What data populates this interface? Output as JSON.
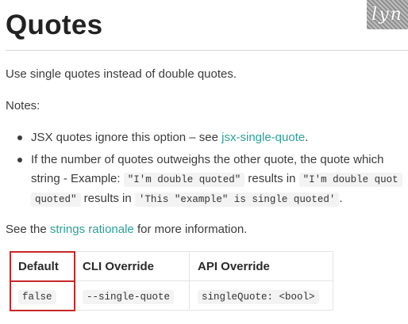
{
  "header": {
    "title": "Quotes",
    "logo_text": "lyn"
  },
  "content": {
    "intro": "Use single quotes instead of double quotes.",
    "notes_label": "Notes:",
    "bullet1": {
      "text": "JSX quotes ignore this option – see ",
      "link": "jsx-single-quote",
      "end": "."
    },
    "bullet2": {
      "line1": "If the number of quotes outweighs the other quote, the quote which",
      "line2_prefix": "string - Example: ",
      "code1": "\"I'm double quoted\"",
      "results_in": " results in ",
      "code2": "\"I'm double quot",
      "code2_cont": "quoted\"",
      "results_in_2": " results in ",
      "code3": "'This \"example\" is single quoted'",
      "end": "."
    },
    "see": {
      "prefix": "See the ",
      "link": "strings rationale",
      "suffix": " for more information."
    }
  },
  "table": {
    "headers": [
      "Default",
      "CLI Override",
      "API Override"
    ],
    "row": [
      "false",
      "--single-quote",
      "singleQuote: <bool>"
    ]
  },
  "colors": {
    "link": "#2aa198",
    "highlight": "#c62828"
  }
}
